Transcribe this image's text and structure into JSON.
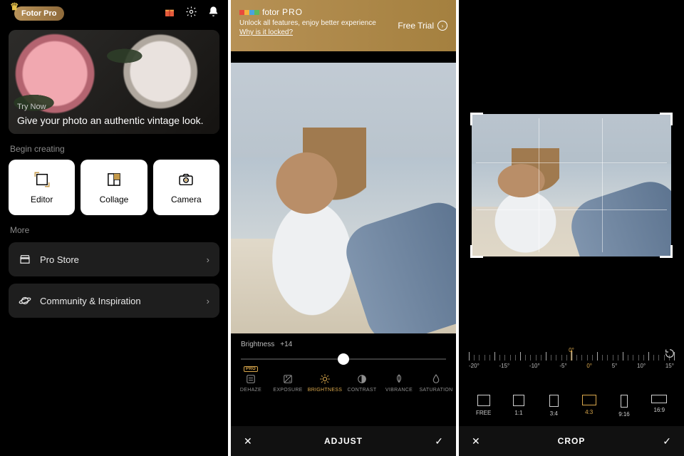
{
  "screen1": {
    "pro_badge": "Fotor Pro",
    "hero": {
      "try_now": "Try Now",
      "title": "Give your photo an authentic vintage look."
    },
    "begin_creating": "Begin creating",
    "tiles": {
      "editor": "Editor",
      "collage": "Collage",
      "camera": "Camera"
    },
    "more": "More",
    "items": {
      "pro_store": "Pro Store",
      "community": "Community & Inspiration"
    }
  },
  "screen2": {
    "banner": {
      "brand": "fotor",
      "pro": "PRO",
      "subtitle": "Unlock all features, enjoy better experience",
      "locked": "Why is it locked?",
      "free_trial": "Free Trial"
    },
    "slider": {
      "label": "Brightness",
      "value": "+14"
    },
    "tools": {
      "pro_badge": "PRO",
      "dehaze": "DEHAZE",
      "exposure": "EXPOSURE",
      "brightness": "BRIGHTNESS",
      "contrast": "CONTRAST",
      "vibrance": "VIBRANCE",
      "saturation": "SATURATION"
    },
    "bottom_title": "ADJUST"
  },
  "screen3": {
    "angles": {
      "n20": "-20°",
      "n15": "-15°",
      "n10": "-10°",
      "n5": "-5°",
      "zero": "0°",
      "p5": "5°",
      "p10": "10°",
      "p15": "15°"
    },
    "ratios": {
      "free": "FREE",
      "r11": "1:1",
      "r34": "3:4",
      "r43": "4:3",
      "r916": "9:16",
      "r169": "16:9"
    },
    "bottom_title": "CROP"
  }
}
